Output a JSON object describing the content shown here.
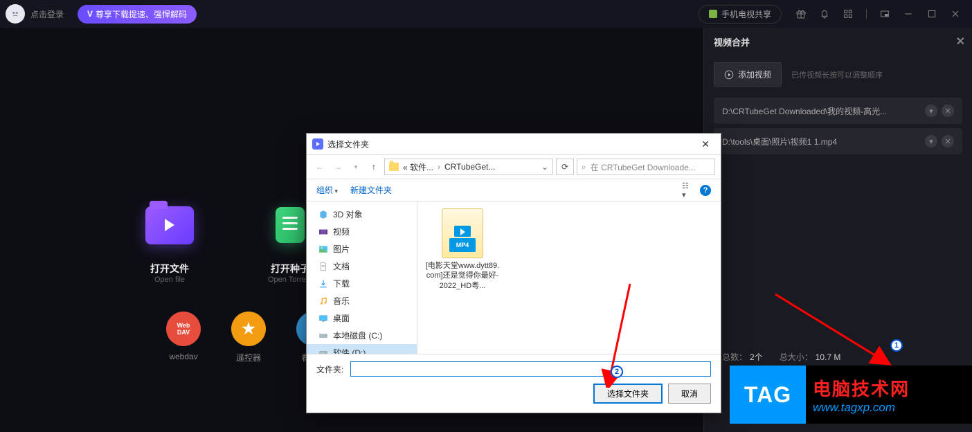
{
  "topbar": {
    "login": "点击登录",
    "promo": "尊享下载提速、强悍解码",
    "phone_share": "手机电视共享"
  },
  "tiles": {
    "open_file": {
      "title": "打开文件",
      "sub": "Open file"
    },
    "open_torrent": {
      "title": "打开种子",
      "sub": "Open Torrent"
    }
  },
  "circles": {
    "webdav": "webdav",
    "remote": "遥控器",
    "tv": "看电视"
  },
  "rightpanel": {
    "title": "视频合并",
    "add_video": "添加视频",
    "hint": "已传视频长按可以调整顺序",
    "items": [
      "D:\\CRTubeGet Downloaded\\我的视频-高光...",
      "D:\\tools\\桌面\\照片\\视频1 1.mp4"
    ],
    "count_label": "片总数：",
    "count_value": "2个",
    "size_label": "总大小：",
    "size_value": "10.7 M"
  },
  "dialog": {
    "title": "选择文件夹",
    "breadcrumb_1": "« 软件...",
    "breadcrumb_2": "CRTubeGet...",
    "search_placeholder": "在 CRTubeGet Downloade...",
    "organize": "组织",
    "new_folder": "新建文件夹",
    "tree": {
      "objects3d": "3D 对象",
      "videos": "视频",
      "pictures": "图片",
      "documents": "文档",
      "downloads": "下载",
      "music": "音乐",
      "desktop": "桌面",
      "drive_c": "本地磁盘 (C:)",
      "drive_d": "软件 (D:)"
    },
    "file_name": "[电影天堂www.dytt89.com]还是觉得你最好-2022_HD粤...",
    "folder_label": "文件夹:",
    "btn_select": "选择文件夹",
    "btn_cancel": "取消"
  },
  "watermark": {
    "tag": "TAG",
    "cn": "电脑技术网",
    "url": "www.tagxp.com"
  },
  "badges": {
    "one": "1",
    "two": "2"
  }
}
